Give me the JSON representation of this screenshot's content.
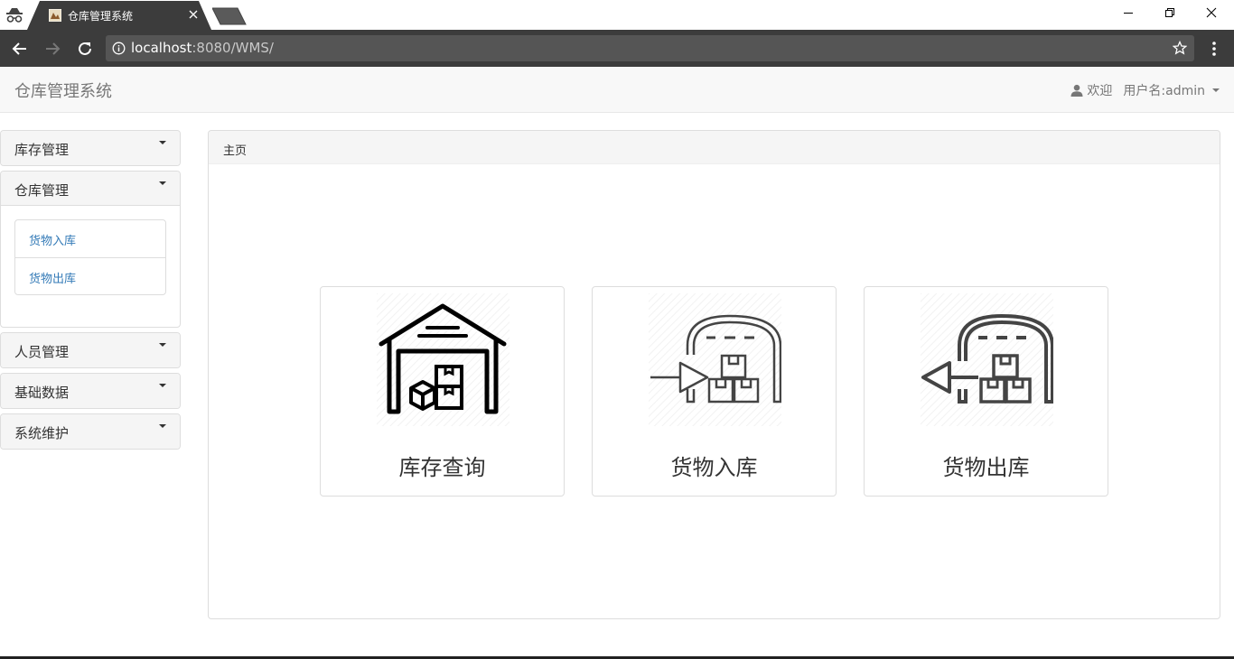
{
  "browser": {
    "tab_title": "仓库管理系统",
    "url_host": "localhost",
    "url_rest": ":8080/WMS/"
  },
  "navbar": {
    "brand": "仓库管理系统",
    "welcome": "欢迎",
    "username": "用户名:admin"
  },
  "sidebar": {
    "panels": [
      {
        "title": "库存管理"
      },
      {
        "title": "仓库管理",
        "items": [
          "货物入库",
          "货物出库"
        ]
      },
      {
        "title": "人员管理"
      },
      {
        "title": "基础数据"
      },
      {
        "title": "系统维护"
      }
    ]
  },
  "main": {
    "heading": "主页",
    "cards": [
      {
        "label": "库存查询",
        "icon": "warehouse-icon"
      },
      {
        "label": "货物入库",
        "icon": "inbound-icon"
      },
      {
        "label": "货物出库",
        "icon": "outbound-icon"
      }
    ]
  }
}
